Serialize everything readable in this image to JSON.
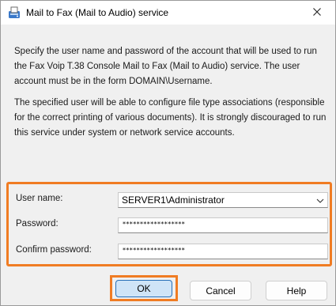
{
  "window": {
    "title": "Mail to Fax (Mail to Audio) service",
    "icon": "mail-fax-app-icon",
    "close_icon": "close-icon"
  },
  "description": {
    "paragraph1": "Specify the user name and password of the account that will be used to run the Fax Voip T.38 Console Mail to Fax (Mail to Audio) service. The user account must be in the form DOMAIN\\Username.",
    "paragraph2": "The specified user will be able to configure file type associations (responsible for the correct printing of various documents). It is strongly discouraged to run this service under system or network service accounts."
  },
  "form": {
    "username_label": "User name:",
    "username_value": "SERVER1\\Administrator",
    "password_label": "Password:",
    "password_value": "******************",
    "confirm_label": "Confirm password:",
    "confirm_value": "******************"
  },
  "buttons": {
    "ok": "OK",
    "cancel": "Cancel",
    "help": "Help"
  },
  "colors": {
    "highlight": "#f07c23",
    "ok_focus_border": "#2870b8",
    "ok_focus_fill": "#cfe4f7"
  }
}
